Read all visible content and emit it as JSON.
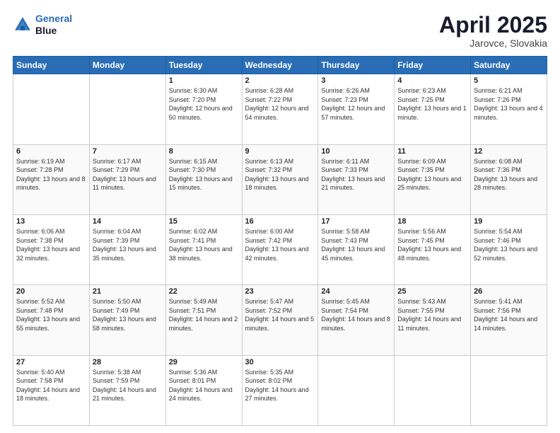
{
  "header": {
    "logo_line1": "General",
    "logo_line2": "Blue",
    "month": "April 2025",
    "location": "Jarovce, Slovakia"
  },
  "days_of_week": [
    "Sunday",
    "Monday",
    "Tuesday",
    "Wednesday",
    "Thursday",
    "Friday",
    "Saturday"
  ],
  "weeks": [
    [
      {
        "day": "",
        "sunrise": "",
        "sunset": "",
        "daylight": ""
      },
      {
        "day": "",
        "sunrise": "",
        "sunset": "",
        "daylight": ""
      },
      {
        "day": "1",
        "sunrise": "Sunrise: 6:30 AM",
        "sunset": "Sunset: 7:20 PM",
        "daylight": "Daylight: 12 hours and 50 minutes."
      },
      {
        "day": "2",
        "sunrise": "Sunrise: 6:28 AM",
        "sunset": "Sunset: 7:22 PM",
        "daylight": "Daylight: 12 hours and 54 minutes."
      },
      {
        "day": "3",
        "sunrise": "Sunrise: 6:26 AM",
        "sunset": "Sunset: 7:23 PM",
        "daylight": "Daylight: 12 hours and 57 minutes."
      },
      {
        "day": "4",
        "sunrise": "Sunrise: 6:23 AM",
        "sunset": "Sunset: 7:25 PM",
        "daylight": "Daylight: 13 hours and 1 minute."
      },
      {
        "day": "5",
        "sunrise": "Sunrise: 6:21 AM",
        "sunset": "Sunset: 7:26 PM",
        "daylight": "Daylight: 13 hours and 4 minutes."
      }
    ],
    [
      {
        "day": "6",
        "sunrise": "Sunrise: 6:19 AM",
        "sunset": "Sunset: 7:28 PM",
        "daylight": "Daylight: 13 hours and 8 minutes."
      },
      {
        "day": "7",
        "sunrise": "Sunrise: 6:17 AM",
        "sunset": "Sunset: 7:29 PM",
        "daylight": "Daylight: 13 hours and 11 minutes."
      },
      {
        "day": "8",
        "sunrise": "Sunrise: 6:15 AM",
        "sunset": "Sunset: 7:30 PM",
        "daylight": "Daylight: 13 hours and 15 minutes."
      },
      {
        "day": "9",
        "sunrise": "Sunrise: 6:13 AM",
        "sunset": "Sunset: 7:32 PM",
        "daylight": "Daylight: 13 hours and 18 minutes."
      },
      {
        "day": "10",
        "sunrise": "Sunrise: 6:11 AM",
        "sunset": "Sunset: 7:33 PM",
        "daylight": "Daylight: 13 hours and 21 minutes."
      },
      {
        "day": "11",
        "sunrise": "Sunrise: 6:09 AM",
        "sunset": "Sunset: 7:35 PM",
        "daylight": "Daylight: 13 hours and 25 minutes."
      },
      {
        "day": "12",
        "sunrise": "Sunrise: 6:08 AM",
        "sunset": "Sunset: 7:36 PM",
        "daylight": "Daylight: 13 hours and 28 minutes."
      }
    ],
    [
      {
        "day": "13",
        "sunrise": "Sunrise: 6:06 AM",
        "sunset": "Sunset: 7:38 PM",
        "daylight": "Daylight: 13 hours and 32 minutes."
      },
      {
        "day": "14",
        "sunrise": "Sunrise: 6:04 AM",
        "sunset": "Sunset: 7:39 PM",
        "daylight": "Daylight: 13 hours and 35 minutes."
      },
      {
        "day": "15",
        "sunrise": "Sunrise: 6:02 AM",
        "sunset": "Sunset: 7:41 PM",
        "daylight": "Daylight: 13 hours and 38 minutes."
      },
      {
        "day": "16",
        "sunrise": "Sunrise: 6:00 AM",
        "sunset": "Sunset: 7:42 PM",
        "daylight": "Daylight: 13 hours and 42 minutes."
      },
      {
        "day": "17",
        "sunrise": "Sunrise: 5:58 AM",
        "sunset": "Sunset: 7:43 PM",
        "daylight": "Daylight: 13 hours and 45 minutes."
      },
      {
        "day": "18",
        "sunrise": "Sunrise: 5:56 AM",
        "sunset": "Sunset: 7:45 PM",
        "daylight": "Daylight: 13 hours and 48 minutes."
      },
      {
        "day": "19",
        "sunrise": "Sunrise: 5:54 AM",
        "sunset": "Sunset: 7:46 PM",
        "daylight": "Daylight: 13 hours and 52 minutes."
      }
    ],
    [
      {
        "day": "20",
        "sunrise": "Sunrise: 5:52 AM",
        "sunset": "Sunset: 7:48 PM",
        "daylight": "Daylight: 13 hours and 55 minutes."
      },
      {
        "day": "21",
        "sunrise": "Sunrise: 5:50 AM",
        "sunset": "Sunset: 7:49 PM",
        "daylight": "Daylight: 13 hours and 58 minutes."
      },
      {
        "day": "22",
        "sunrise": "Sunrise: 5:49 AM",
        "sunset": "Sunset: 7:51 PM",
        "daylight": "Daylight: 14 hours and 2 minutes."
      },
      {
        "day": "23",
        "sunrise": "Sunrise: 5:47 AM",
        "sunset": "Sunset: 7:52 PM",
        "daylight": "Daylight: 14 hours and 5 minutes."
      },
      {
        "day": "24",
        "sunrise": "Sunrise: 5:45 AM",
        "sunset": "Sunset: 7:54 PM",
        "daylight": "Daylight: 14 hours and 8 minutes."
      },
      {
        "day": "25",
        "sunrise": "Sunrise: 5:43 AM",
        "sunset": "Sunset: 7:55 PM",
        "daylight": "Daylight: 14 hours and 11 minutes."
      },
      {
        "day": "26",
        "sunrise": "Sunrise: 5:41 AM",
        "sunset": "Sunset: 7:56 PM",
        "daylight": "Daylight: 14 hours and 14 minutes."
      }
    ],
    [
      {
        "day": "27",
        "sunrise": "Sunrise: 5:40 AM",
        "sunset": "Sunset: 7:58 PM",
        "daylight": "Daylight: 14 hours and 18 minutes."
      },
      {
        "day": "28",
        "sunrise": "Sunrise: 5:38 AM",
        "sunset": "Sunset: 7:59 PM",
        "daylight": "Daylight: 14 hours and 21 minutes."
      },
      {
        "day": "29",
        "sunrise": "Sunrise: 5:36 AM",
        "sunset": "Sunset: 8:01 PM",
        "daylight": "Daylight: 14 hours and 24 minutes."
      },
      {
        "day": "30",
        "sunrise": "Sunrise: 5:35 AM",
        "sunset": "Sunset: 8:02 PM",
        "daylight": "Daylight: 14 hours and 27 minutes."
      },
      {
        "day": "",
        "sunrise": "",
        "sunset": "",
        "daylight": ""
      },
      {
        "day": "",
        "sunrise": "",
        "sunset": "",
        "daylight": ""
      },
      {
        "day": "",
        "sunrise": "",
        "sunset": "",
        "daylight": ""
      }
    ]
  ]
}
